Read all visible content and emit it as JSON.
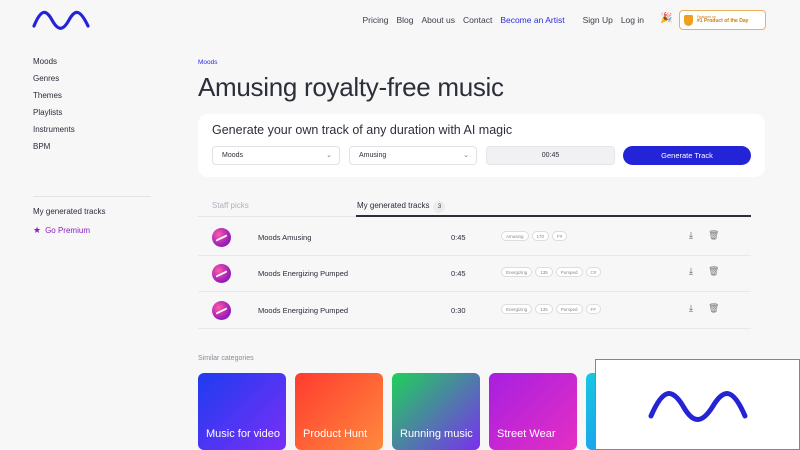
{
  "nav": {
    "links": [
      "Pricing",
      "Blog",
      "About us",
      "Contact"
    ],
    "artist": "Become an Artist",
    "signup": "Sign Up",
    "login": "Log in",
    "party_icon": "🎉",
    "badge_top": "Featured on",
    "badge_main": "#1 Product of the Day"
  },
  "sidebar": {
    "items": [
      "Moods",
      "Genres",
      "Themes",
      "Playlists",
      "Instruments",
      "BPM"
    ],
    "my_tracks": "My generated tracks",
    "premium": "Go Premium"
  },
  "main": {
    "breadcrumb": "Moods",
    "title": "Amusing royalty-free music"
  },
  "generator": {
    "title": "Generate your own track of any duration with AI magic",
    "select1": "Moods",
    "select2": "Amusing",
    "duration": "00:45",
    "button": "Generate Track"
  },
  "tabs": {
    "staff": "Staff picks",
    "mine": "My generated tracks",
    "count": "3"
  },
  "tracks": [
    {
      "name": "Moods Amusing",
      "duration": "0:45",
      "tags": [
        "Amusing",
        "170",
        "F#"
      ]
    },
    {
      "name": "Moods Energizing Pumped",
      "duration": "0:45",
      "tags": [
        "Energizing",
        "135",
        "Pumped",
        "C#"
      ]
    },
    {
      "name": "Moods Energizing Pumped",
      "duration": "0:30",
      "tags": [
        "Energizing",
        "135",
        "Pumped",
        "F#"
      ]
    }
  ],
  "similar": {
    "title": "Similar categories",
    "cards": [
      {
        "label": "Music for video",
        "colors": [
          "#1e3cf0",
          "#7b2ff7"
        ]
      },
      {
        "label": "Product Hunt",
        "colors": [
          "#ff3b2f",
          "#ff8a3d"
        ]
      },
      {
        "label": "Running music",
        "colors": [
          "#1fd15a",
          "#7a2ff0"
        ]
      },
      {
        "label": "Street Wear",
        "colors": [
          "#a61fe0",
          "#e62fc4"
        ]
      },
      {
        "label": "",
        "colors": [
          "#17c8e0",
          "#1ca0f0"
        ]
      }
    ]
  },
  "colors": {
    "accent": "#2323d8",
    "premium": "#8b1fbf",
    "logo": "#2424d6"
  }
}
